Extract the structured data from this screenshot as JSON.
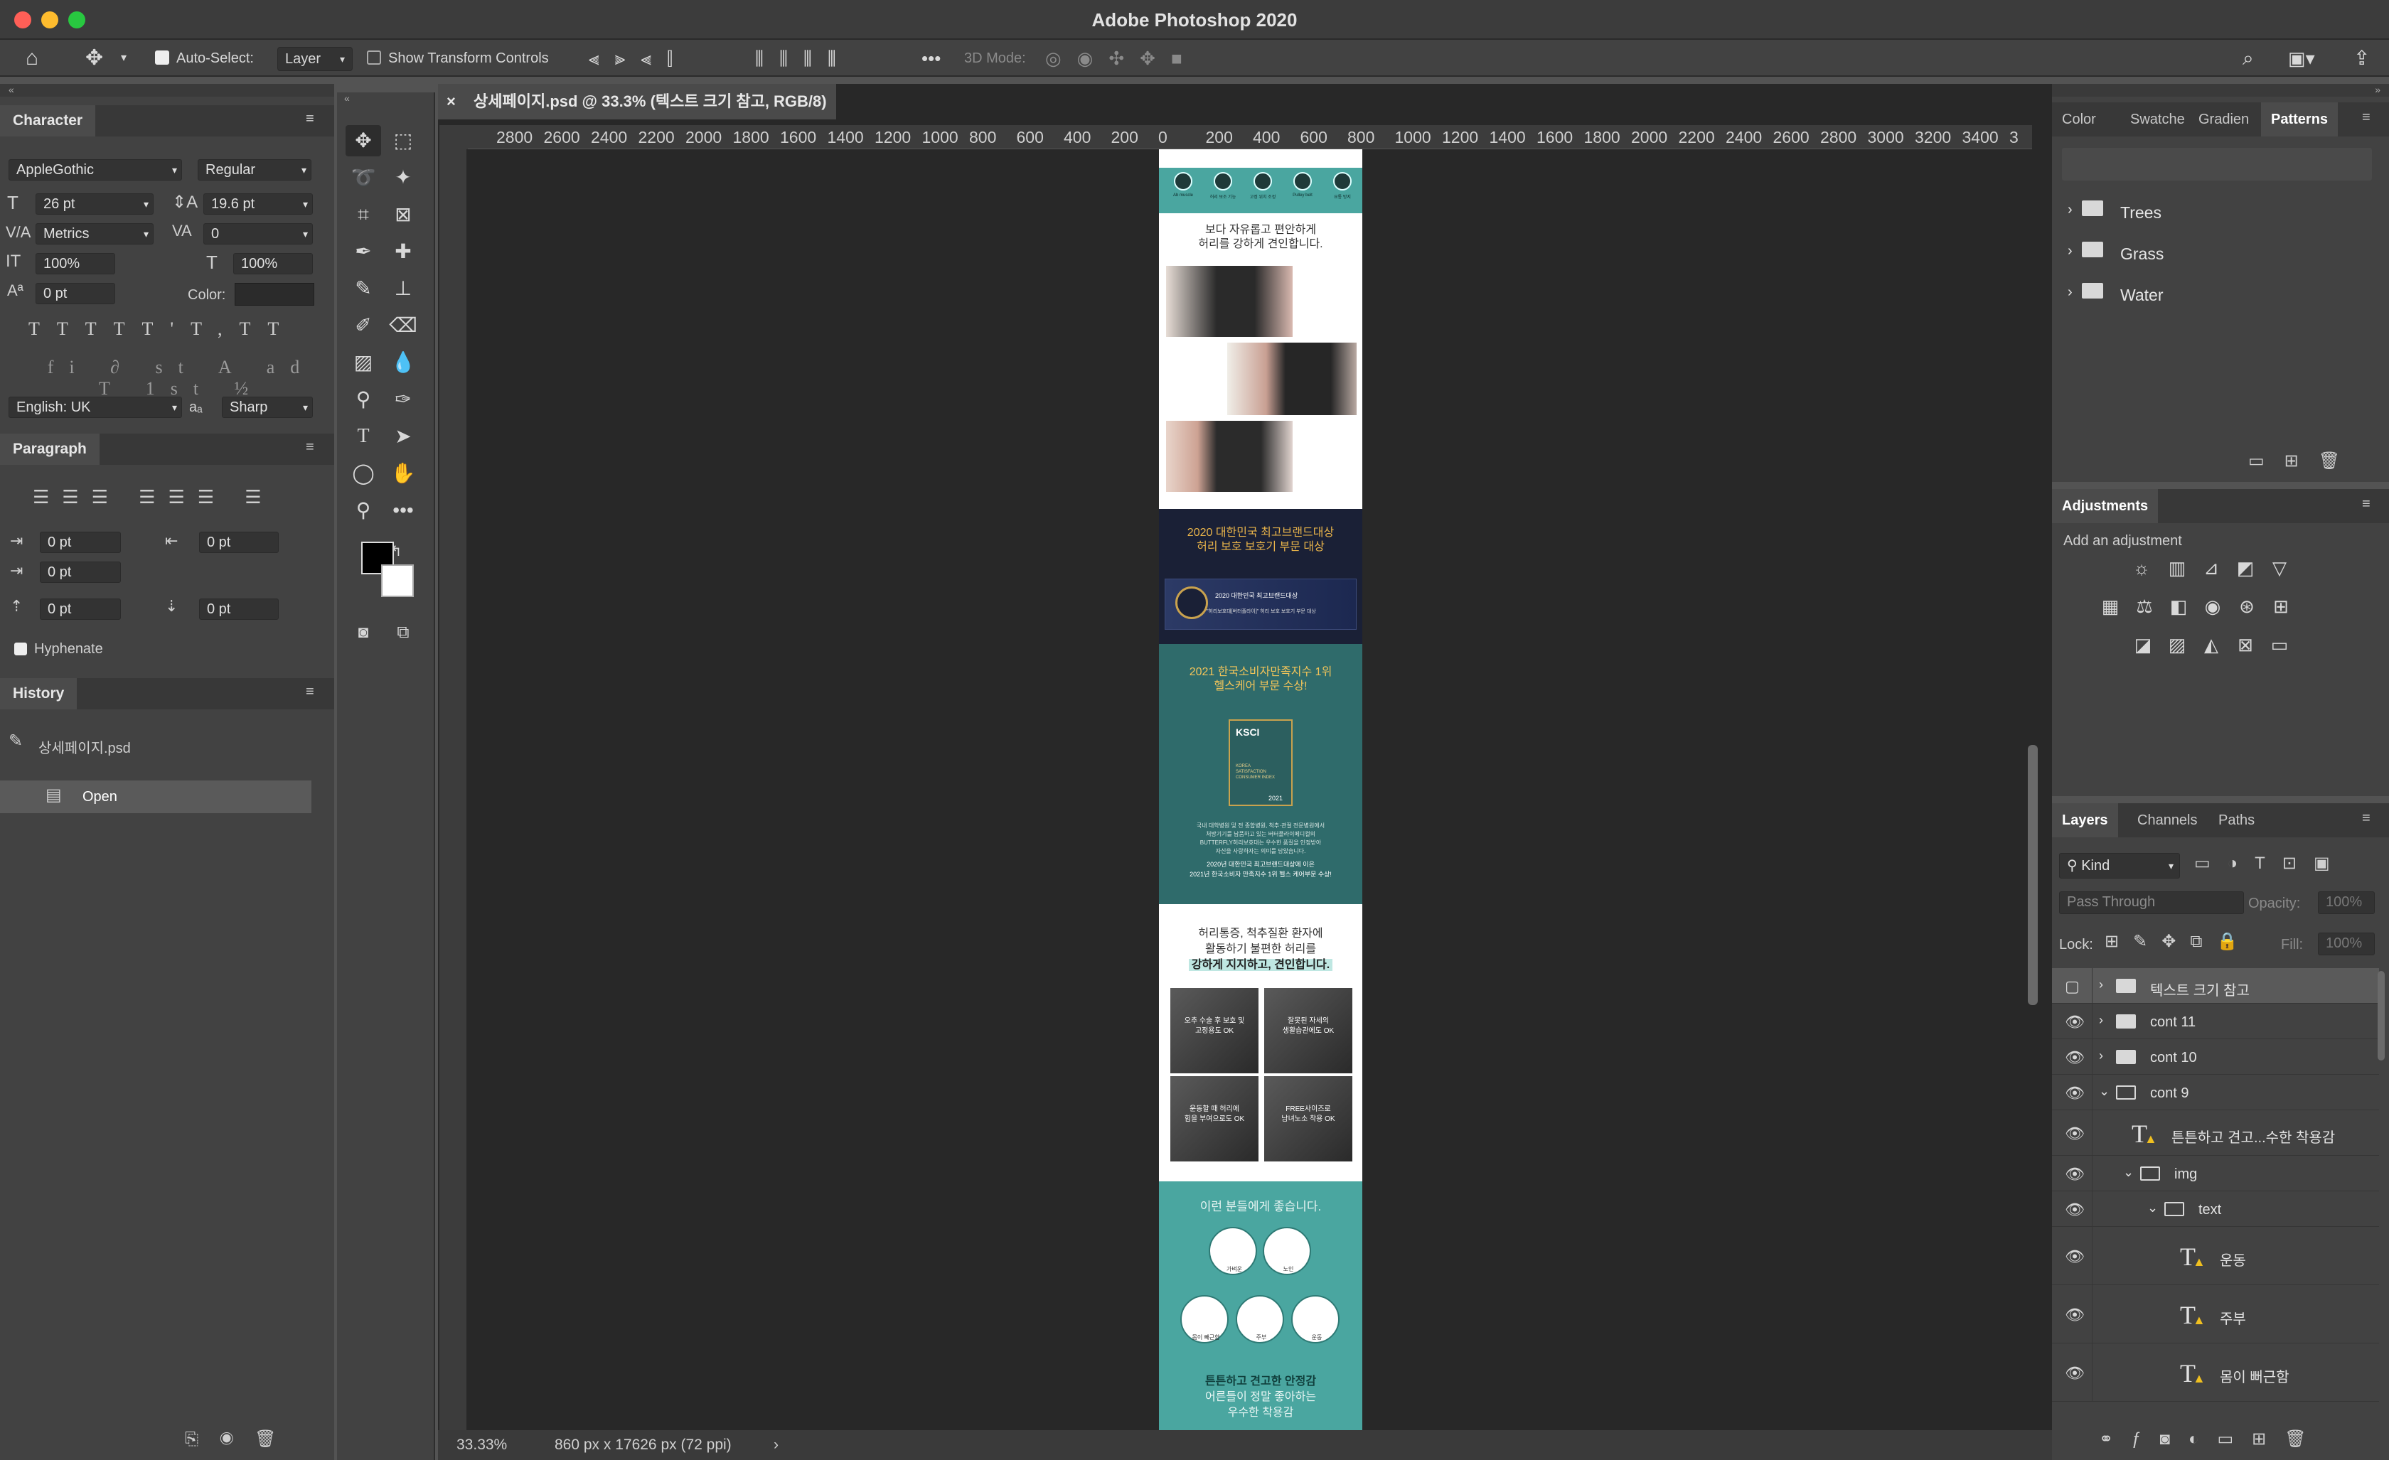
{
  "app": {
    "title": "Adobe Photoshop 2020"
  },
  "options": {
    "auto_select_label": "Auto-Select:",
    "auto_select_value": "Layer",
    "transform_label": "Show Transform Controls",
    "mode3d": "3D Mode:"
  },
  "character": {
    "tab": "Character",
    "font": "AppleGothic",
    "style": "Regular",
    "size": "26 pt",
    "leading": "19.6 pt",
    "kerning": "Metrics",
    "tracking": "0",
    "vscale": "100%",
    "hscale": "100%",
    "baseline": "0 pt",
    "color_label": "Color:",
    "language": "English: UK",
    "aa_label": "aₐ",
    "antialias": "Sharp"
  },
  "paragraph": {
    "tab": "Paragraph",
    "indent_left": "0 pt",
    "indent_right": "0 pt",
    "indent_first": "0 pt",
    "space_before": "0 pt",
    "space_after": "0 pt",
    "hyphenate": "Hyphenate"
  },
  "history": {
    "tab": "History",
    "snapshot": "상세페이지.psd",
    "items": [
      "Open"
    ]
  },
  "document": {
    "tab": "상세페이지.psd @ 33.3% (텍스트 크기 참고, RGB/8)",
    "zoom": "33.33%",
    "info": "860 px x 17626 px (72 ppi)",
    "ruler": [
      "2800",
      "2600",
      "2400",
      "2200",
      "2000",
      "1800",
      "1600",
      "1400",
      "1200",
      "1000",
      "800",
      "600",
      "400",
      "200",
      "0",
      "200",
      "400",
      "600",
      "800",
      "1000",
      "1200",
      "1400",
      "1600",
      "1800",
      "2000",
      "2200",
      "2400",
      "2600",
      "2800",
      "3000",
      "3200",
      "3400",
      "3"
    ]
  },
  "canvas": {
    "s1_icons": [
      "Ab muscle",
      "허리 보조 기능",
      "고정 위치 조정",
      "Pulley belt",
      "요통 방지"
    ],
    "s1_text1": "보다 자유롭고 편안하게",
    "s1_text2": "허리를 강하게 견인합니다.",
    "s2_line1": "2020 대한민국 최고브랜드대상",
    "s2_line2": "허리 보호 보호기 부문 대상",
    "s2_banner1": "2020 대한민국 최고브랜드대상",
    "s2_banner2": "\"허리보호대[버터플라이]\" 허리 보호 보호기 부문 대상",
    "s3_line1": "2021 한국소비자만족지수 1위",
    "s3_line2": "헬스케어 부문 수상!",
    "s3_badge": "KSCI",
    "s3_badge_sub": "KOREA SATISFACTION CONSUMER INDEX",
    "s3_badge_year": "2021",
    "s3_body1": "국내 대학병원 및 전 종합병원, 척추·관절 전문병원에서",
    "s3_body2": "처방기기를 납품하고 있는 버터플라이메디컬의",
    "s3_body3": "BUTTERFLY허리보호대는 우수한 품질을 인정받아",
    "s3_body4": "자신을 사랑하자는 의미를 담았습니다.",
    "s3_body5": "2020년 대한민국 최고브랜드대상에 이은",
    "s3_body6": "2021년 한국소비자 만족지수 1위 헬스 케어부문 수상!",
    "s4_line1": "허리통증, 척추질환 환자에",
    "s4_line2": "활동하기 불편한 허리를",
    "s4_line3": "강하게 지지하고, 견인합니다.",
    "s4_cards": [
      "오추 수술 후 보호 및\n고정용도 OK",
      "잘못된 자세의\n생활습관에도 OK",
      "운동할 때 허리에\n힘을 부여으로도 OK",
      "FREE사이즈로\n남녀노소 착용 OK"
    ],
    "s5_title": "이런 분들에게 좋습니다.",
    "s5_people": [
      "가벼운",
      "노인",
      "몸이 빼근함",
      "주부",
      "운동"
    ],
    "s5_bottom1": "튼튼하고 견고한 안정감",
    "s5_bottom2": "어른들이 정말 좋아하는",
    "s5_bottom3": "우수한 착용감"
  },
  "right_top": {
    "tabs": [
      "Color",
      "Swatche",
      "Gradien",
      "Patterns"
    ],
    "active": "Patterns",
    "folders": [
      "Trees",
      "Grass",
      "Water"
    ]
  },
  "adjustments": {
    "tab": "Adjustments",
    "hint": "Add an adjustment"
  },
  "layers": {
    "tabs": [
      "Layers",
      "Channels",
      "Paths"
    ],
    "filter": "Kind",
    "blend": "Pass Through",
    "opacity_label": "Opacity:",
    "opacity": "100%",
    "lock_label": "Lock:",
    "fill_label": "Fill:",
    "fill": "100%",
    "rows": [
      {
        "name": "텍스트 크기 참고",
        "kind": "group",
        "indent": 0,
        "open": false,
        "visible": false,
        "selected": true
      },
      {
        "name": "cont 11",
        "kind": "group",
        "indent": 0,
        "open": false,
        "visible": true
      },
      {
        "name": "cont 10",
        "kind": "group",
        "indent": 0,
        "open": false,
        "visible": true
      },
      {
        "name": "cont 9",
        "kind": "group",
        "indent": 0,
        "open": true,
        "visible": true
      },
      {
        "name": "튼튼하고 견고...수한 착용감",
        "kind": "text",
        "indent": 1,
        "visible": true
      },
      {
        "name": "img",
        "kind": "group",
        "indent": 1,
        "open": true,
        "visible": true
      },
      {
        "name": "text",
        "kind": "group",
        "indent": 2,
        "open": true,
        "visible": true
      },
      {
        "name": "운동",
        "kind": "text",
        "indent": 3,
        "visible": true
      },
      {
        "name": "주부",
        "kind": "text",
        "indent": 3,
        "visible": true
      },
      {
        "name": "몸이 뻐근함",
        "kind": "text",
        "indent": 3,
        "visible": true
      }
    ]
  },
  "colors": {
    "accent_teal": "#4aa6a0",
    "navy": "#1d2640",
    "teal_dark": "#2f6b6b",
    "gold": "#e8b34a"
  }
}
